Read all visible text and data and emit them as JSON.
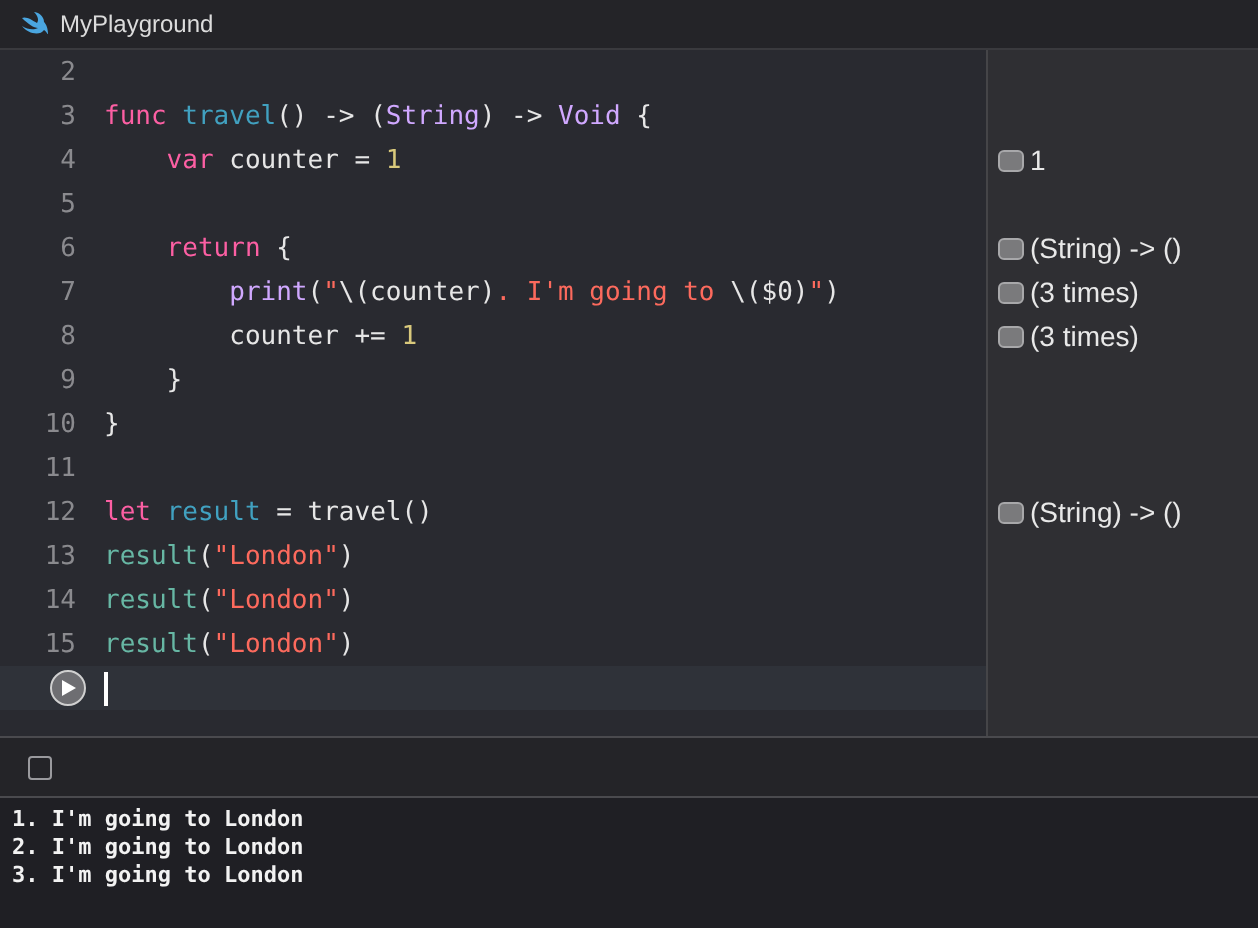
{
  "window": {
    "title": "MyPlayground"
  },
  "editor": {
    "lines": [
      {
        "number": "2"
      },
      {
        "number": "3",
        "tokens": [
          {
            "kind": "keyword",
            "text": "func "
          },
          {
            "kind": "declaration",
            "text": "travel"
          },
          {
            "kind": "plain",
            "text": "() -> ("
          },
          {
            "kind": "type",
            "text": "String"
          },
          {
            "kind": "plain",
            "text": ") -> "
          },
          {
            "kind": "type",
            "text": "Void"
          },
          {
            "kind": "plain",
            "text": " {"
          }
        ]
      },
      {
        "number": "4",
        "tokens": [
          {
            "kind": "keyword",
            "text": "    var"
          },
          {
            "kind": "plain",
            "text": " counter = "
          },
          {
            "kind": "number",
            "text": "1"
          }
        ],
        "result": "1"
      },
      {
        "number": "5"
      },
      {
        "number": "6",
        "tokens": [
          {
            "kind": "keyword",
            "text": "    return"
          },
          {
            "kind": "plain",
            "text": " {"
          }
        ],
        "result": "(String) -> ()"
      },
      {
        "number": "7",
        "tokens": [
          {
            "kind": "type",
            "text": "        print"
          },
          {
            "kind": "plain",
            "text": "("
          },
          {
            "kind": "string",
            "text": "\""
          },
          {
            "kind": "plain",
            "text": "\\(counter)"
          },
          {
            "kind": "string",
            "text": ". I'm going to "
          },
          {
            "kind": "plain",
            "text": "\\($0)"
          },
          {
            "kind": "string",
            "text": "\""
          },
          {
            "kind": "plain",
            "text": ")"
          }
        ],
        "result": "(3 times)"
      },
      {
        "number": "8",
        "tokens": [
          {
            "kind": "plain",
            "text": "        counter += "
          },
          {
            "kind": "number",
            "text": "1"
          }
        ],
        "result": "(3 times)"
      },
      {
        "number": "9",
        "tokens": [
          {
            "kind": "plain",
            "text": "    }"
          }
        ]
      },
      {
        "number": "10",
        "tokens": [
          {
            "kind": "plain",
            "text": "}"
          }
        ]
      },
      {
        "number": "11"
      },
      {
        "number": "12",
        "tokens": [
          {
            "kind": "keyword",
            "text": "let "
          },
          {
            "kind": "declaration",
            "text": "result"
          },
          {
            "kind": "plain",
            "text": " = travel()"
          }
        ],
        "result": "(String) -> ()"
      },
      {
        "number": "13",
        "tokens": [
          {
            "kind": "usage",
            "text": "result"
          },
          {
            "kind": "plain",
            "text": "("
          },
          {
            "kind": "string",
            "text": "\"London\""
          },
          {
            "kind": "plain",
            "text": ")"
          }
        ]
      },
      {
        "number": "14",
        "tokens": [
          {
            "kind": "usage",
            "text": "result"
          },
          {
            "kind": "plain",
            "text": "("
          },
          {
            "kind": "string",
            "text": "\"London\""
          },
          {
            "kind": "plain",
            "text": ")"
          }
        ]
      },
      {
        "number": "15",
        "tokens": [
          {
            "kind": "usage",
            "text": "result"
          },
          {
            "kind": "plain",
            "text": "("
          },
          {
            "kind": "string",
            "text": "\"London\""
          },
          {
            "kind": "plain",
            "text": ")"
          }
        ]
      },
      {
        "run_button": true,
        "current": true
      }
    ]
  },
  "debug_bar": {
    "console_toggle_checked": false
  },
  "console": {
    "lines": [
      "1. I'm going to London",
      "2. I'm going to London",
      "3. I'm going to London"
    ]
  }
}
